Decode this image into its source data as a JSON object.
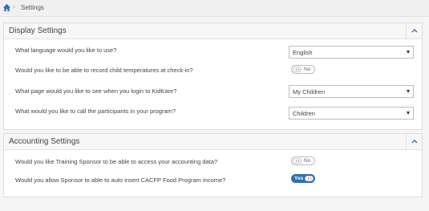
{
  "breadcrumb": {
    "home_icon": "home-icon",
    "separator": "›",
    "current": "Settings"
  },
  "display": {
    "title": "Display Settings",
    "collapse_icon": "chevron-up-icon",
    "language_q": "What language would you like to use?",
    "language_value": "English",
    "temp_q": "Would you like to be able to record child temperatures at check-in?",
    "temp_toggle": "No",
    "page_q": "What page would you like to see when you login to KidKare?",
    "page_value": "My Children",
    "participants_q": "What would you like to call the participants in your program?",
    "participants_value": "Children"
  },
  "accounting": {
    "title": "Accounting Settings",
    "collapse_icon": "chevron-up-icon",
    "sponsor_q": "Would you like Training Sponsor to be able to access your accounting data?",
    "sponsor_toggle": "No",
    "cacfp_q": "Would you allow Sponsor to able to auto insert CACFP Food Program income?",
    "cacfp_toggle": "Yes"
  },
  "colors": {
    "toggle_on": "#2f6fb0",
    "header_bg": "#f7f7f7",
    "breadcrumb_bg": "#f0f0f0"
  }
}
